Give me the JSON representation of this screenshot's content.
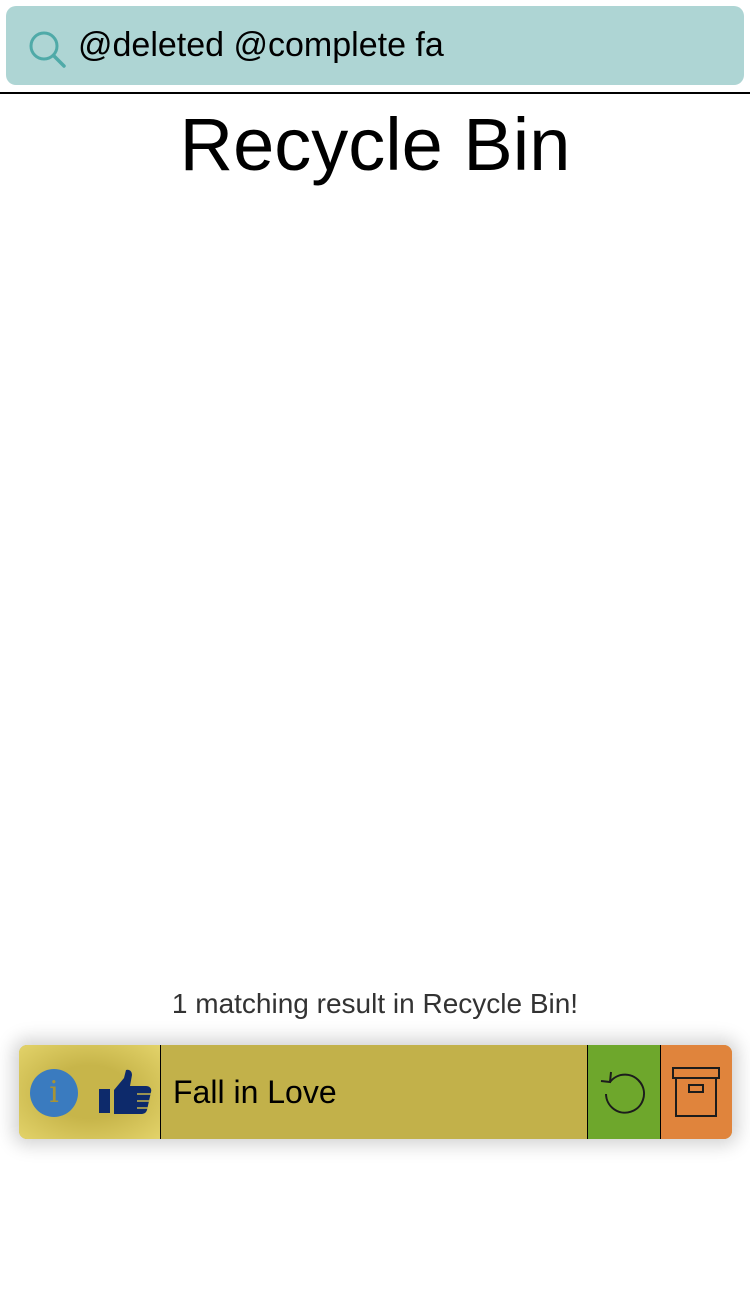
{
  "search": {
    "value": "@deleted @complete fa",
    "icon": "search-icon"
  },
  "page": {
    "title": "Recycle Bin"
  },
  "results": {
    "summary": "1 matching result in Recycle Bin!",
    "items": [
      {
        "title": "Fall in Love",
        "info_icon": "info-icon",
        "info_glyph": "i",
        "like_icon": "thumbs-up-icon",
        "restore_icon": "restore-icon",
        "archive_icon": "archive-box-icon"
      }
    ]
  },
  "colors": {
    "search_bg": "#aed5d4",
    "row_bg": "#c2b14a",
    "info_blue": "#3a7bbf",
    "thumb_navy": "#0d2a6b",
    "restore_green": "#6ea72c",
    "archive_orange": "#e0843c"
  }
}
